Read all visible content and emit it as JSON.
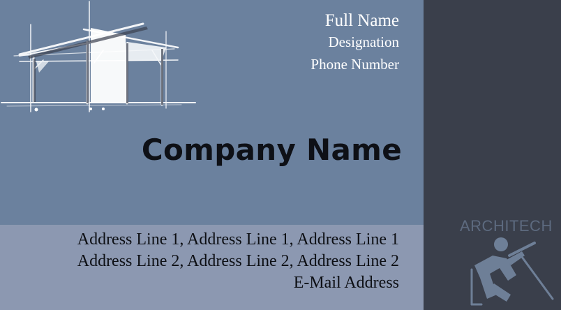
{
  "card": {
    "full_name": "Full Name",
    "designation": "Designation",
    "phone": "Phone Number",
    "company": "Company Name",
    "address_line_1": "Address Line 1, Address Line 1, Address Line 1",
    "address_line_2": "Address Line 2, Address Line 2, Address Line 2",
    "email": "E-Mail Address",
    "brand": "ARCHITECH"
  },
  "colors": {
    "main_panel": "#6b819e",
    "address_panel": "#8c98b1",
    "side_panel": "#3a3f4b",
    "brand_text": "#5d6a7f",
    "company_text": "#0e1016"
  },
  "icons": {
    "sketch": "house-sketch-illustration",
    "logo": "architect-figure-logo"
  }
}
